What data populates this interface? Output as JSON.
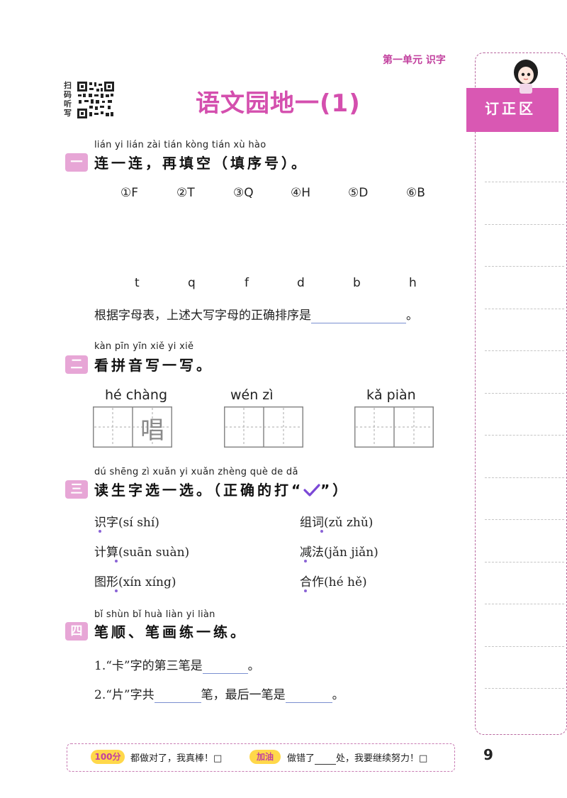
{
  "header": {
    "unit": "第一单元  识字"
  },
  "qr": {
    "label": "扫码听写"
  },
  "title": "语文园地一(1)",
  "sidebar": {
    "tab_label": "订正区"
  },
  "section1": {
    "badge": "一",
    "pinyin": "lián yi lián   zài tián kòng   tián xù hào",
    "title": "连一连，再填空（填序号）。",
    "uppercase": [
      "①F",
      "②T",
      "③Q",
      "④H",
      "⑤D",
      "⑥B"
    ],
    "lowercase": [
      "t",
      "q",
      "f",
      "d",
      "b",
      "h"
    ],
    "sentence": "根据字母表，上述大写字母的正确排序是",
    "end_punct": "。"
  },
  "section2": {
    "badge": "二",
    "pinyin": "kàn pīn yīn xiě yi xiě",
    "title": "看拼音写一写。",
    "words": [
      {
        "pinyin": "hé  chàng",
        "example_char": "唱"
      },
      {
        "pinyin": "wén   zì",
        "example_char": ""
      },
      {
        "pinyin": "kǎ  piàn",
        "example_char": ""
      }
    ]
  },
  "section3": {
    "badge": "三",
    "pinyin": "dú shēng zì xuǎn yi xuǎn       zhèng què de dǎ",
    "title_a": "读生字选一选。（正确的打“",
    "title_b": "”）",
    "left_items": [
      "识字(sí   shí)",
      "计算(suān   suàn)",
      "图形(xín   xíng)"
    ],
    "right_items": [
      "组词(zǔ   zhǔ)",
      "减法(jǎn   jiǎn)",
      "合作(hé   hě)"
    ]
  },
  "section4": {
    "badge": "四",
    "pinyin": "bǐ shùn   bǐ huà liàn yi liàn",
    "title": "笔顺、笔画练一练。",
    "q1_a": "1.“卡”字的第三笔是",
    "q1_b": "。",
    "q2_a": "2.“片”字共",
    "q2_b": "笔，最后一笔是",
    "q2_c": "。"
  },
  "footer": {
    "score_badge": "100分",
    "text1": "都做对了，我真棒！□",
    "cheer_badge": "加油",
    "text2a": "做错了",
    "text2b": "处，我要继续努力！□"
  },
  "page_number": "9"
}
